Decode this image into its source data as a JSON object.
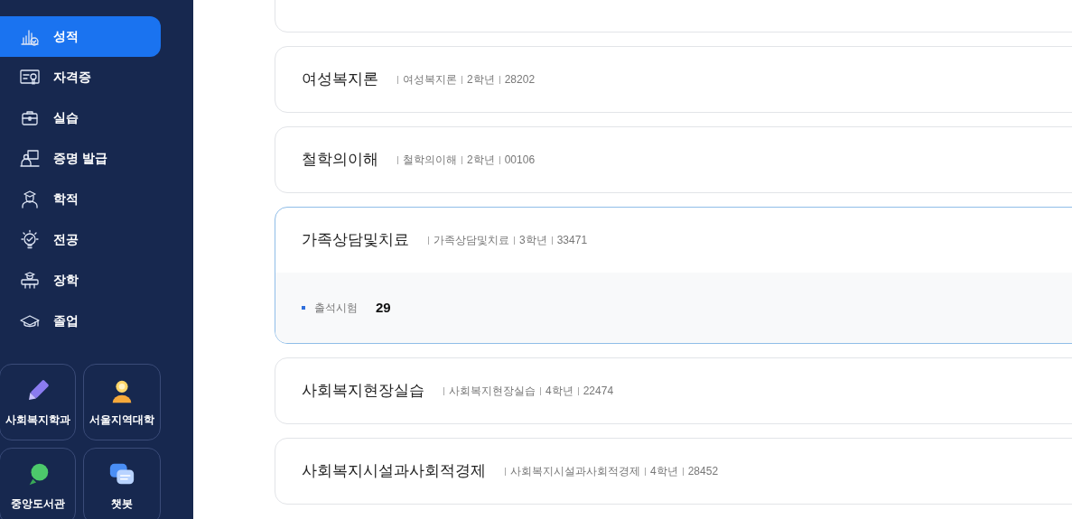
{
  "sidebar": {
    "items": [
      {
        "label": "성적",
        "selected": true
      },
      {
        "label": "자격증",
        "selected": false
      },
      {
        "label": "실습",
        "selected": false
      },
      {
        "label": "증명 발급",
        "selected": false
      },
      {
        "label": "학적",
        "selected": false
      },
      {
        "label": "전공",
        "selected": false
      },
      {
        "label": "장학",
        "selected": false
      },
      {
        "label": "졸업",
        "selected": false
      }
    ],
    "tiles": [
      {
        "label": "사회복지학과"
      },
      {
        "label": "서울지역대학"
      },
      {
        "label": "중앙도서관"
      },
      {
        "label": "챗봇"
      }
    ]
  },
  "courses": [
    {
      "title": "여성복지론",
      "meta": [
        "여성복지론",
        "2학년",
        "28202"
      ],
      "expanded": false
    },
    {
      "title": "철학의이해",
      "meta": [
        "철학의이해",
        "2학년",
        "00106"
      ],
      "expanded": false
    },
    {
      "title": "가족상담및치료",
      "meta": [
        "가족상담및치료",
        "3학년",
        "33471"
      ],
      "expanded": true,
      "details": [
        {
          "label": "출석시험",
          "value": "29"
        }
      ]
    },
    {
      "title": "사회복지현장실습",
      "meta": [
        "사회복지현장실습",
        "4학년",
        "22474"
      ],
      "expanded": false
    },
    {
      "title": "사회복지시설과사회적경제",
      "meta": [
        "사회복지시설과사회적경제",
        "4학년",
        "28452"
      ],
      "expanded": false
    }
  ]
}
